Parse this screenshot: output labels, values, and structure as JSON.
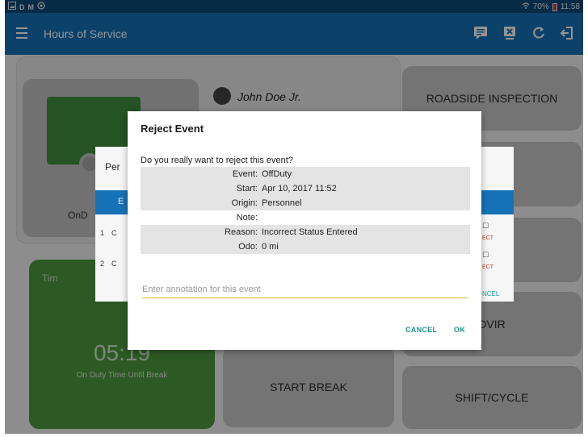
{
  "status_bar": {
    "left_icons": [
      "image-icon",
      "D",
      "M",
      "network-icon"
    ],
    "left_d": "D",
    "left_m": "M",
    "battery": "70%",
    "time": "11:58"
  },
  "toolbar": {
    "title": "Hours of Service",
    "icons": [
      "message-icon",
      "disconnect-icon",
      "refresh-icon",
      "logout-icon"
    ]
  },
  "background": {
    "driver_name": "John Doe Jr.",
    "status_fragment": "OnD",
    "time_label_fragment": "Tim",
    "big_time_fragment": "05:19",
    "green_subtitle": "On Duty Time Until Break",
    "buttons": {
      "roadside": "ROADSIDE INSPECTION",
      "fragment_is": "IS",
      "dvir": "DVIR",
      "start_break": "START BREAK",
      "shift_cycle": "SHIFT/CYCLE"
    },
    "bg_dialog": {
      "title_fragment": "Per",
      "bar_fragment": "E",
      "row1_num": "1",
      "row2_num": "2",
      "row_c": "C",
      "reject_fragment": "ECT",
      "cancel_fragment": "NCEL"
    }
  },
  "dialog": {
    "title": "Reject Event",
    "question": "Do you really want to reject this event?",
    "details": [
      {
        "label": "Event:",
        "value": "OffDuty"
      },
      {
        "label": "Start:",
        "value": "Apr 10, 2017 11:52"
      },
      {
        "label": "Origin:",
        "value": "Personnel"
      },
      {
        "label": "Note:",
        "value": ""
      },
      {
        "label": "Reason:",
        "value": "Incorrect Status Entered"
      },
      {
        "label": "Odo:",
        "value": "0 mi"
      }
    ],
    "annotation_placeholder": "Enter annotation for this event",
    "annotation_value": "",
    "cancel_label": "CANCEL",
    "ok_label": "OK"
  },
  "colors": {
    "toolbar": "#1672b7",
    "status_bar": "#0c4b7a",
    "accent_teal": "#17968a",
    "input_underline": "#e0b629",
    "green_card": "#4e9b3e"
  }
}
